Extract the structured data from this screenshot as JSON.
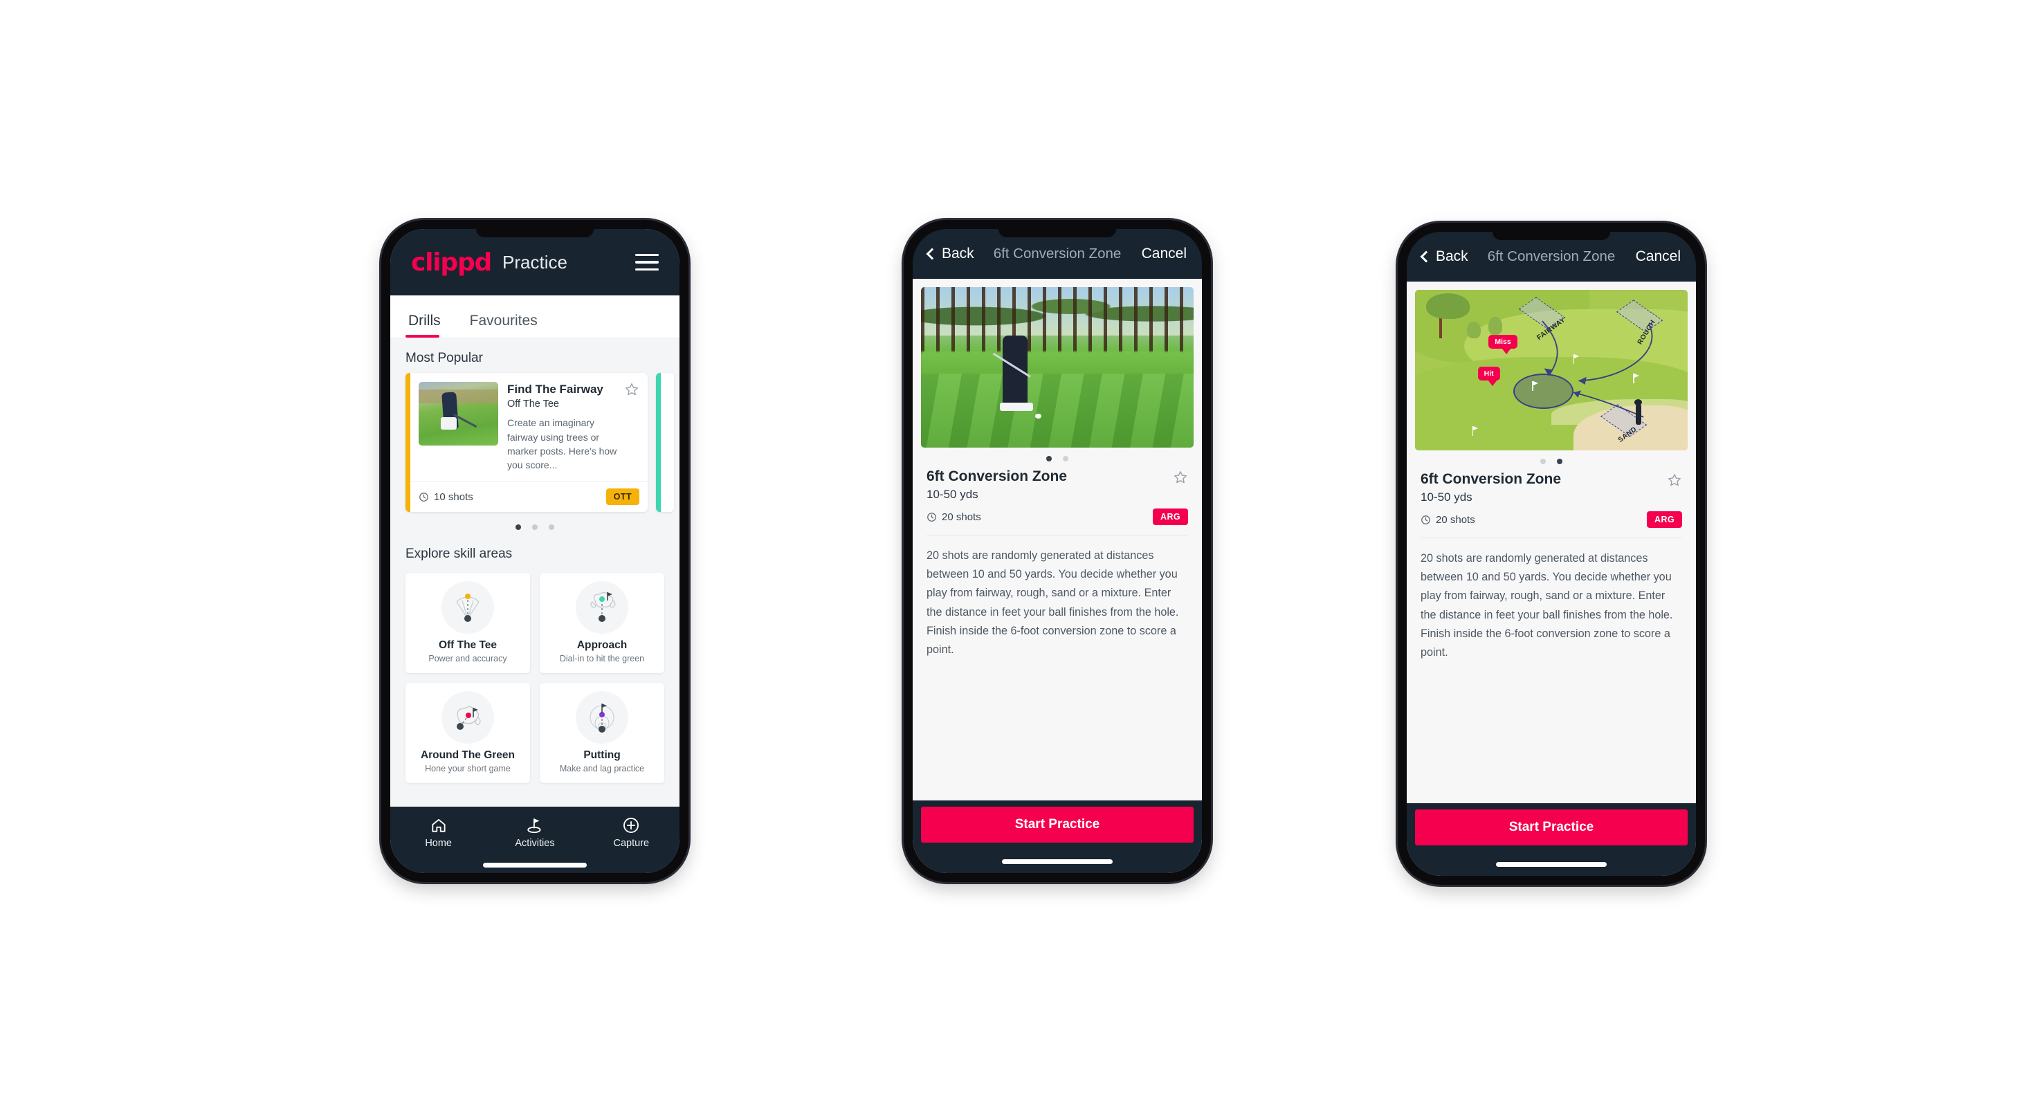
{
  "app": {
    "brand": "clippd",
    "accent": "#f5004f",
    "dark": "#18242f"
  },
  "phone1": {
    "header": {
      "title": "Practice",
      "menu_icon": "hamburger-icon"
    },
    "tabs": [
      {
        "label": "Drills",
        "active": true
      },
      {
        "label": "Favourites",
        "active": false
      }
    ],
    "sections": {
      "most_popular": "Most Popular",
      "explore": "Explore skill areas"
    },
    "drill_card": {
      "name": "Find The Fairway",
      "category": "Off The Tee",
      "description": "Create an imaginary fairway using trees or marker posts. Here's how you score...",
      "shots": "10 shots",
      "badge": "OTT",
      "accent_color": "#f5b20b",
      "next_accent_color": "#3ed6b0",
      "star_icon": "star-outline-icon",
      "clock_icon": "clock-icon"
    },
    "carousel_dots": {
      "count": 3,
      "active_index": 0
    },
    "skill_areas": [
      {
        "name": "Off The Tee",
        "sub": "Power and accuracy",
        "icon": "tee-fan-icon",
        "dot_color": "#f5b20b"
      },
      {
        "name": "Approach",
        "sub": "Dial-in to hit the green",
        "icon": "approach-green-icon",
        "dot_color": "#3ed6b0"
      },
      {
        "name": "Around The Green",
        "sub": "Hone your short game",
        "icon": "around-green-icon",
        "dot_color": "#f5004f"
      },
      {
        "name": "Putting",
        "sub": "Make and lag practice",
        "icon": "putting-rings-icon",
        "dot_color": "#8b30d6"
      }
    ],
    "bottom_nav": [
      {
        "label": "Home",
        "icon": "home-icon",
        "active": false
      },
      {
        "label": "Activities",
        "icon": "golf-flag-icon",
        "active": true
      },
      {
        "label": "Capture",
        "icon": "plus-circle-icon",
        "active": false
      }
    ]
  },
  "phone2": {
    "header": {
      "back": "Back",
      "title": "6ft Conversion Zone",
      "cancel": "Cancel",
      "back_icon": "chevron-left-icon"
    },
    "media": {
      "kind": "photo",
      "alt": "golfer chipping on a green with pine trees"
    },
    "dots": {
      "count": 2,
      "active_index": 0
    },
    "detail": {
      "title": "6ft Conversion Zone",
      "distance": "10-50 yds",
      "shots": "20 shots",
      "badge": "ARG",
      "star_icon": "star-outline-icon",
      "clock_icon": "clock-icon",
      "description": "20 shots are randomly generated at distances between 10 and 50 yards. You decide whether you play from fairway, rough, sand or a mixture. Enter the distance in feet your ball finishes from the hole. Finish inside the 6-foot conversion zone to score a point."
    },
    "cta": "Start Practice"
  },
  "phone3": {
    "header": {
      "back": "Back",
      "title": "6ft Conversion Zone",
      "cancel": "Cancel",
      "back_icon": "chevron-left-icon"
    },
    "media": {
      "kind": "illustration",
      "zones": [
        "FAIRWAY",
        "ROUGH",
        "SAND"
      ],
      "pins": [
        "Miss",
        "Hit"
      ]
    },
    "dots": {
      "count": 2,
      "active_index": 1
    },
    "detail": {
      "title": "6ft Conversion Zone",
      "distance": "10-50 yds",
      "shots": "20 shots",
      "badge": "ARG",
      "star_icon": "star-outline-icon",
      "clock_icon": "clock-icon",
      "description": "20 shots are randomly generated at distances between 10 and 50 yards. You decide whether you play from fairway, rough, sand or a mixture. Enter the distance in feet your ball finishes from the hole. Finish inside the 6-foot conversion zone to score a point."
    },
    "cta": "Start Practice"
  }
}
